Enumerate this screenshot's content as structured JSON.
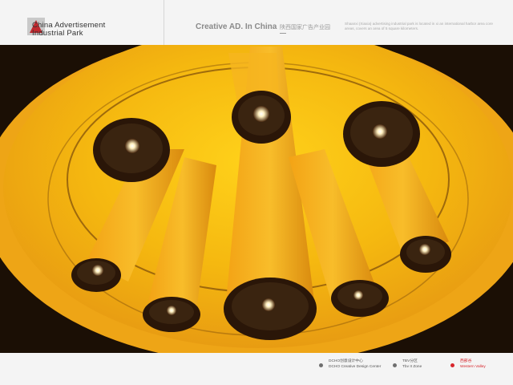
{
  "header": {
    "logo_line1": "China Advertisement",
    "logo_line2": "Industrial Park",
    "tagline_en": "Creative AD. In China",
    "tagline_cn": "陕西国家广告产业园",
    "intro": "Shaanxi (Xiaxia) advertising industrial park is located in xi an international harbor area core areas, covers an area of 5 square kilometers."
  },
  "footer": {
    "nav": [
      {
        "line1": "DCHO创意设计中心",
        "line2": "DCHO Creative Design Center",
        "active": false
      },
      {
        "line1": "TBV分区",
        "line2": "Tbv II Zone",
        "active": false
      },
      {
        "line1": "西部谷",
        "line2": "Western Valley",
        "active": true
      }
    ]
  },
  "colors": {
    "accent_red": "#d7262c",
    "hero_yellow": "#f2c21a",
    "hero_orange": "#e79a12",
    "hero_dark": "#1a0e04"
  },
  "icons": {
    "logo": "triangle-logo-icon",
    "nav_bullet": "dot-icon"
  }
}
